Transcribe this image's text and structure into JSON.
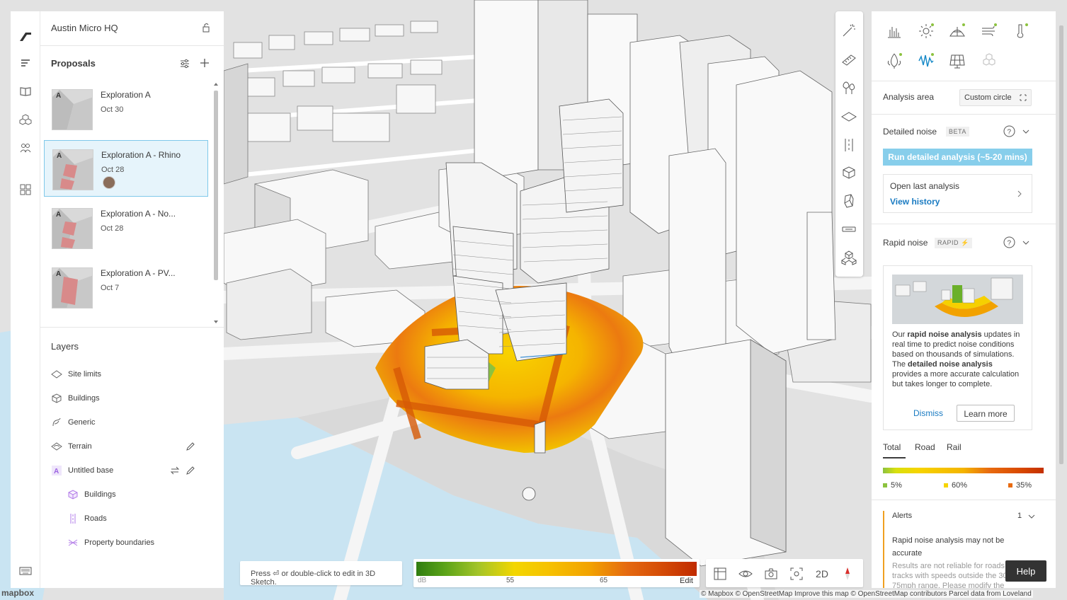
{
  "project": {
    "title": "Austin Micro HQ"
  },
  "proposals": {
    "title": "Proposals",
    "items": [
      {
        "name": "Exploration A",
        "date": "Oct 30",
        "letter": "A"
      },
      {
        "name": "Exploration A - Rhino",
        "date": "Oct 28",
        "letter": "A"
      },
      {
        "name": "Exploration A - No...",
        "date": "Oct 28",
        "letter": "A"
      },
      {
        "name": "Exploration A - PV...",
        "date": "Oct 7",
        "letter": "A"
      }
    ]
  },
  "layers": {
    "title": "Layers",
    "items": [
      {
        "label": "Site limits",
        "icon": "site-limits-icon"
      },
      {
        "label": "Buildings",
        "icon": "buildings-icon"
      },
      {
        "label": "Generic",
        "icon": "generic-icon"
      },
      {
        "label": "Terrain",
        "icon": "terrain-icon"
      },
      {
        "label": "Untitled base",
        "icon": "base-letter-icon",
        "letter": "A"
      }
    ],
    "sub_items": [
      {
        "label": "Buildings",
        "icon": "buildings-icon"
      },
      {
        "label": "Roads",
        "icon": "roads-icon"
      },
      {
        "label": "Property boundaries",
        "icon": "property-boundaries-icon"
      }
    ]
  },
  "analysis": {
    "area_label": "Analysis area",
    "area_value": "Custom circle",
    "detailed": {
      "title": "Detailed noise",
      "badge": "BETA",
      "run_label": "Run detailed analysis (~5-20 mins)",
      "history_title": "Open last analysis",
      "history_link": "View history"
    },
    "rapid": {
      "title": "Rapid noise",
      "badge": "RAPID",
      "text_1": "Our ",
      "text_bold_1": "rapid noise analysis",
      "text_2": " updates in real time to predict noise conditions based on thousands of simulations. The ",
      "text_bold_2": "detailed noise analysis",
      "text_3": " provides a more accurate calculation but takes longer to complete.",
      "dismiss_label": "Dismiss",
      "learn_more_label": "Learn more"
    },
    "tabs": [
      "Total",
      "Road",
      "Rail"
    ],
    "legend": [
      {
        "label": "5%",
        "color": "#8cc23f"
      },
      {
        "label": "60%",
        "color": "#f6d400"
      },
      {
        "label": "35%",
        "color": "#e86b10"
      }
    ],
    "alerts": {
      "title": "Alerts",
      "count": "1",
      "message": "Rapid noise analysis may not be accurate",
      "detail": "Results are not reliable for roads or rail tracks with speeds outside the 30-75mph range. Please modify the"
    }
  },
  "bottom": {
    "hint": "Press ⏎ or double-click to edit in 3D Sketch.",
    "legend_labels": {
      "unit": "dB",
      "mid": "55",
      "high": "65",
      "edit": "Edit"
    },
    "view_2d": "2D"
  },
  "help_label": "Help",
  "mapbox_label": "mapbox",
  "attribution": "© Mapbox © OpenStreetMap Improve this map © OpenStreetMap contributors Parcel data from Loveland"
}
